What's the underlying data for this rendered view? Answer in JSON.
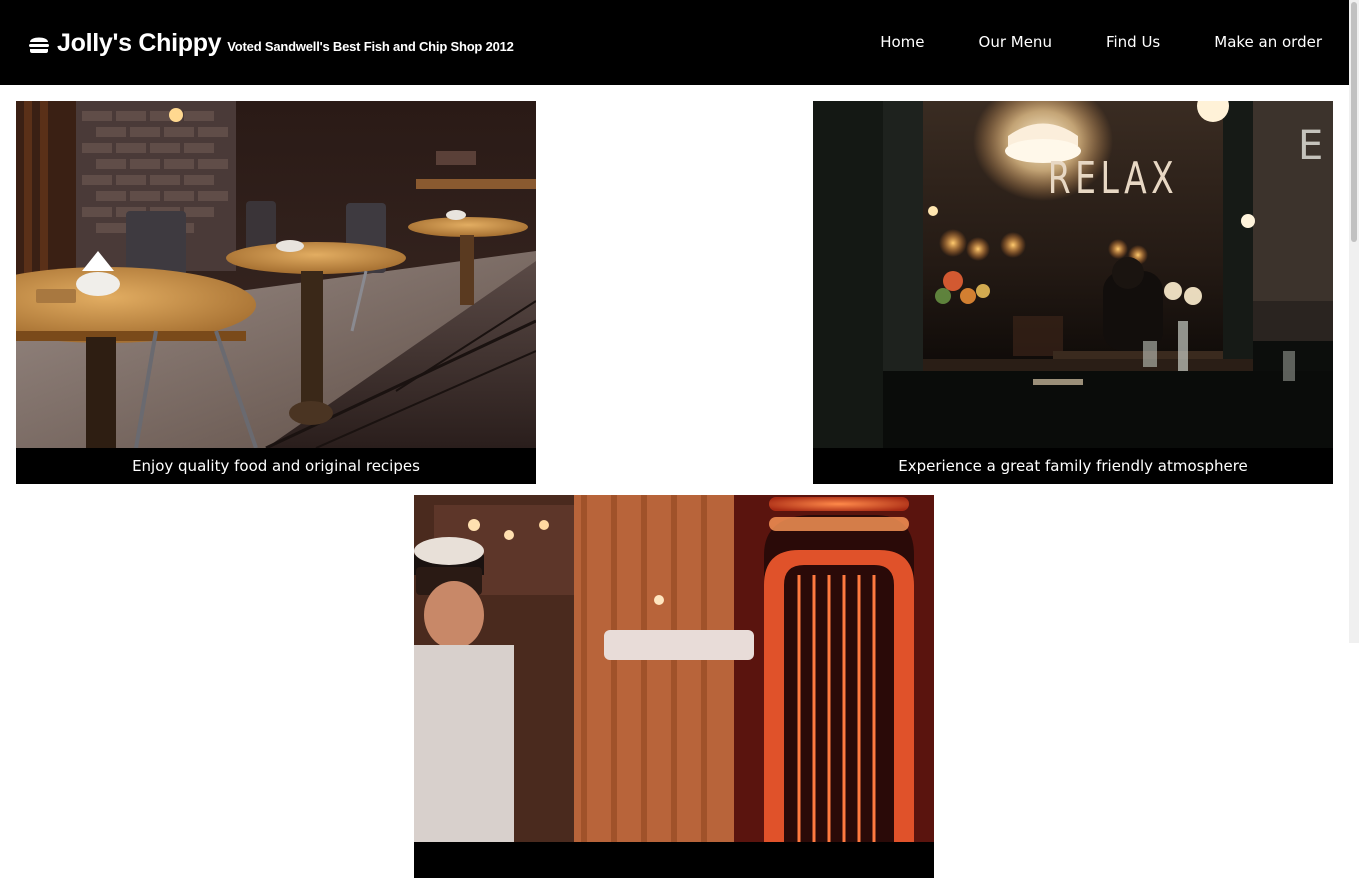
{
  "header": {
    "logo_icon": "burger-icon",
    "title": "Jolly's Chippy",
    "subtitle": "Voted Sandwell's Best Fish and Chip Shop 2012"
  },
  "nav": {
    "items": [
      {
        "label": "Home"
      },
      {
        "label": "Our Menu"
      },
      {
        "label": "Find Us"
      },
      {
        "label": "Make an order"
      }
    ]
  },
  "gallery": {
    "cards": [
      {
        "caption": "Enjoy quality food and original recipes",
        "image": "restaurant-interior-tables-photo"
      },
      {
        "caption": "Experience a great family friendly atmosphere",
        "image": "relax-window-bar-photo"
      },
      {
        "caption": "",
        "image": "chef-kitchen-photo"
      }
    ]
  },
  "photo_text": {
    "window_sign": "RELAX"
  },
  "colors": {
    "header_bg": "#000000",
    "header_text": "#ffffff",
    "page_bg": "#ffffff",
    "caption_bg": "#000000"
  }
}
